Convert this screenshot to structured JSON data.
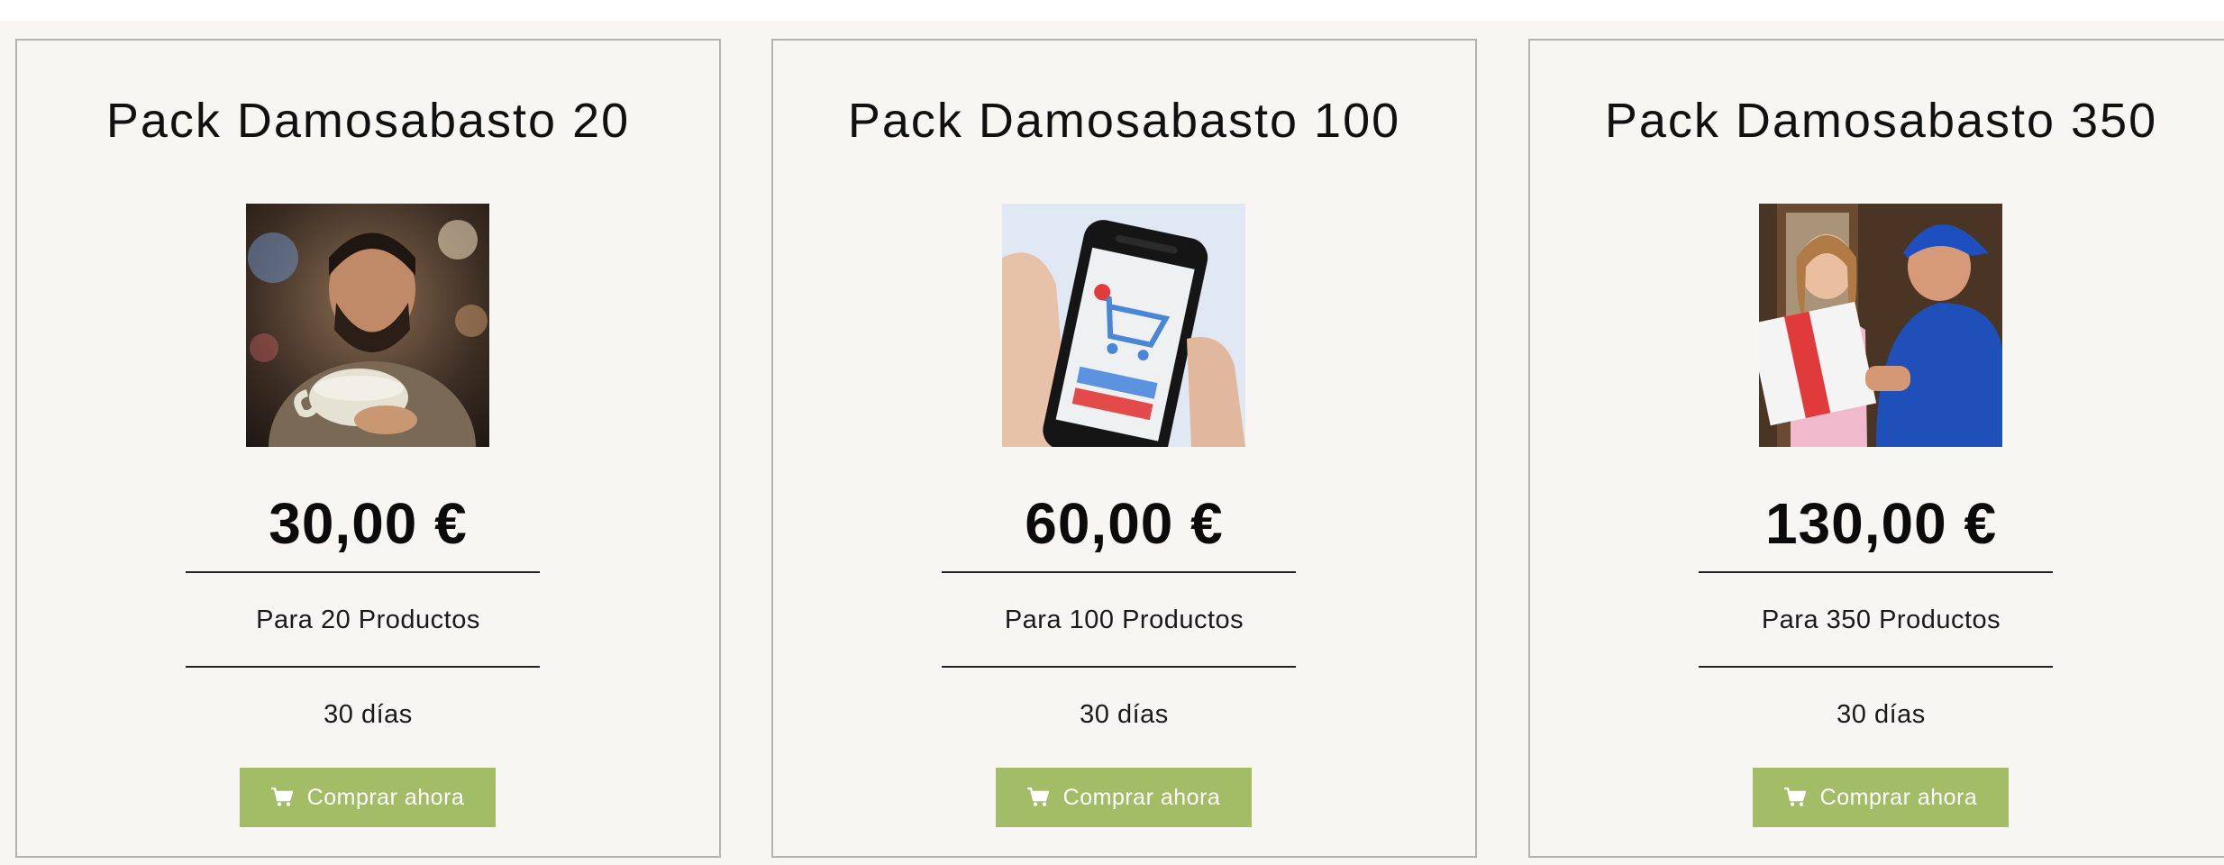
{
  "colors": {
    "background": "#f7f6f2",
    "card_border": "#b4b3ad",
    "button": "#a3bd67",
    "button_text": "#ffffff",
    "text": "#111111"
  },
  "plans": [
    {
      "title": "Pack Damosabasto 20",
      "image_icon": "barista-photo",
      "price": "30,00 €",
      "products": "Para 20 Productos",
      "duration": "30 días",
      "button_label": "Comprar ahora",
      "button_icon": "shopping-cart-icon"
    },
    {
      "title": "Pack Damosabasto 100",
      "image_icon": "phone-shopping-cart-photo",
      "price": "60,00 €",
      "products": "Para 100 Productos",
      "duration": "30 días",
      "button_label": "Comprar ahora",
      "button_icon": "shopping-cart-icon"
    },
    {
      "title": "Pack Damosabasto 350",
      "image_icon": "delivery-photo",
      "price": "130,00 €",
      "products": "Para 350 Productos",
      "duration": "30 días",
      "button_label": "Comprar ahora",
      "button_icon": "shopping-cart-icon"
    }
  ]
}
